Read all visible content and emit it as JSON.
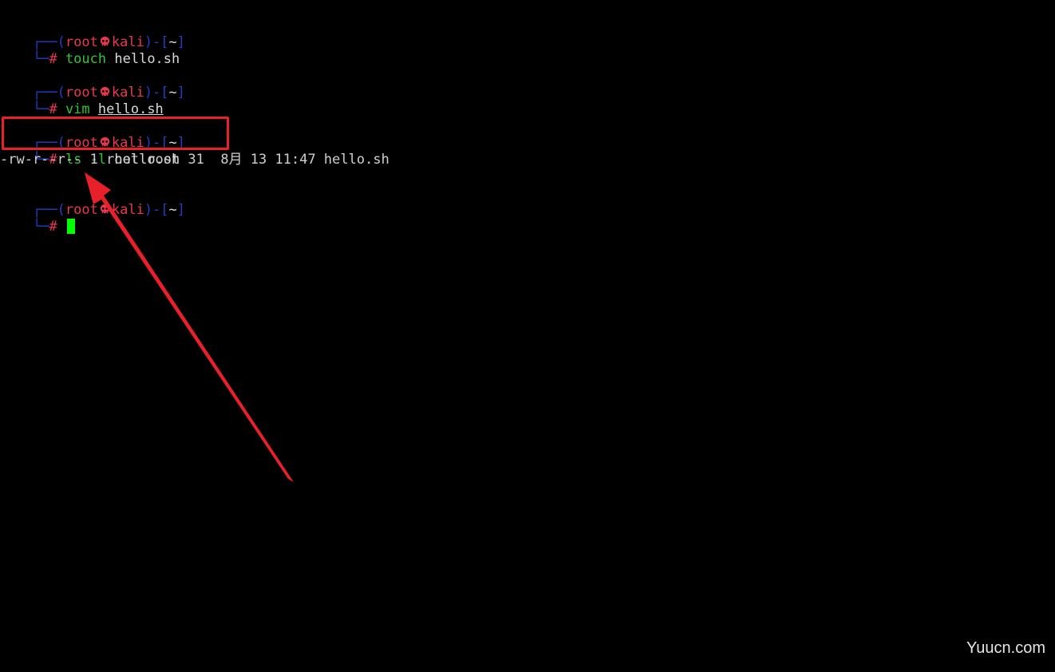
{
  "prompt": {
    "corner_top": "┌──(",
    "user": "root",
    "skull_icon": "skull-icon",
    "host": "kali",
    "mid": ")-[",
    "dir": "~",
    "close": "]",
    "corner_bottom": "└─",
    "hash": "#"
  },
  "commands": [
    {
      "cmd": "touch",
      "arg": "hello.sh"
    },
    {
      "cmd": "vim",
      "arg": "hello.sh"
    },
    {
      "cmd": "ls -l",
      "arg": "hello.sh"
    }
  ],
  "output": "-rw-r--r-- 1 root root 31  8月 13 11:47 hello.sh",
  "annotation": {
    "highlight_color": "#e8202a",
    "arrow_color": "#e8202a"
  },
  "watermark": "Yuucn.com",
  "colors": {
    "prompt_frame": "#1f3fc8",
    "prompt_user": "#e8384f",
    "command": "#34c334",
    "cursor": "#00ff00"
  }
}
